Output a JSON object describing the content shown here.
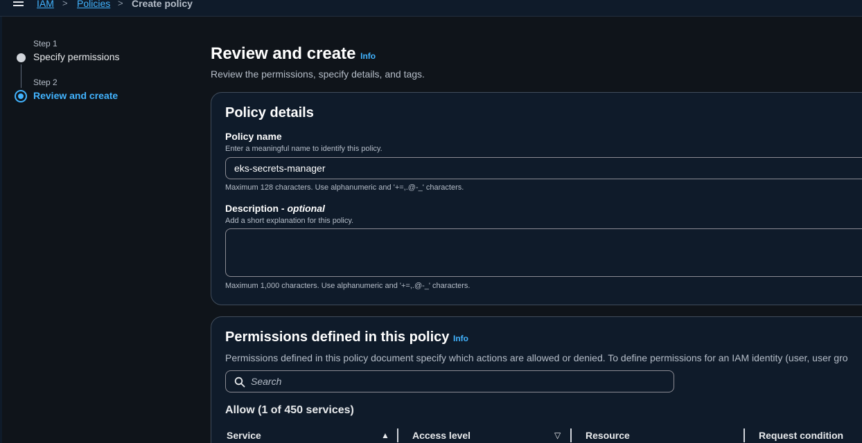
{
  "breadcrumb": {
    "items": [
      "IAM",
      "Policies"
    ],
    "current": "Create policy",
    "separator": ">"
  },
  "steps": [
    {
      "label": "Step 1",
      "title": "Specify permissions",
      "state": "completed"
    },
    {
      "label": "Step 2",
      "title": "Review and create",
      "state": "active"
    }
  ],
  "page": {
    "title": "Review and create",
    "info_label": "Info",
    "description": "Review the permissions, specify details, and tags."
  },
  "policy_details": {
    "title": "Policy details",
    "name_label": "Policy name",
    "name_hint": "Enter a meaningful name to identify this policy.",
    "name_value": "eks-secrets-manager",
    "name_constraint": "Maximum 128 characters. Use alphanumeric and '+=,.@-_' characters.",
    "description_label": "Description - ",
    "description_optional": "optional",
    "description_hint": "Add a short explanation for this policy.",
    "description_value": "",
    "description_constraint": "Maximum 1,000 characters. Use alphanumeric and '+=,.@-_' characters."
  },
  "permissions": {
    "title": "Permissions defined in this policy",
    "info_label": "Info",
    "description": "Permissions defined in this policy document specify which actions are allowed or denied. To define permissions for an IAM identity (user, user gro",
    "search_placeholder": "Search",
    "allow_header": "Allow (1 of 450 services)",
    "columns": [
      "Service",
      "Access level",
      "Resource",
      "Request condition"
    ],
    "sort": {
      "service": "ascending",
      "access_level": "descending"
    }
  },
  "colors": {
    "link": "#42b4ff",
    "panel_bg": "#0f1b2a",
    "page_bg": "#0f141a"
  }
}
